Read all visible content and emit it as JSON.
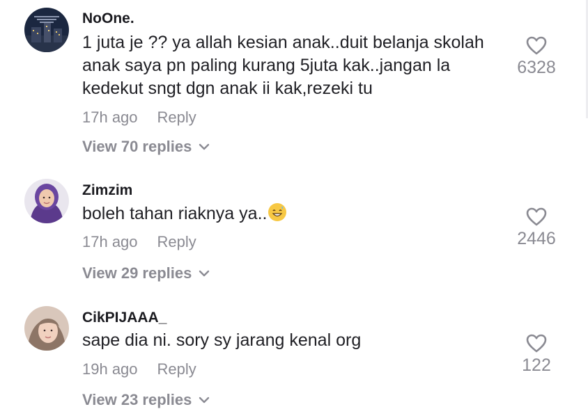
{
  "comments": [
    {
      "username": "NoOne.",
      "text": "1 juta je ?? ya allah kesian anak..duit belanja skolah anak saya pn paling kurang 5juta kak..jangan la kedekut sngt dgn anak ii kak,rezeki tu",
      "time": "17h ago",
      "reply_label": "Reply",
      "view_replies": "View 70 replies",
      "likes": "6328",
      "avatar_icon": "city-skyline-avatar"
    },
    {
      "username": "Zimzim",
      "text": "boleh tahan riaknya ya..",
      "emoji": "grinning-sweat-emoji",
      "time": "17h ago",
      "reply_label": "Reply",
      "view_replies": "View 29 replies",
      "likes": "2446",
      "avatar_icon": "hijab-woman-avatar"
    },
    {
      "username": "CikPIJAAA_",
      "text": "sape dia ni. sory sy jarang kenal org",
      "time": "19h ago",
      "reply_label": "Reply",
      "view_replies": "View 23 replies",
      "likes": "122",
      "avatar_icon": "selfie-woman-avatar"
    }
  ],
  "colors": {
    "text": "#1f1f24",
    "muted": "#8a8a92",
    "background": "#ffffff"
  }
}
